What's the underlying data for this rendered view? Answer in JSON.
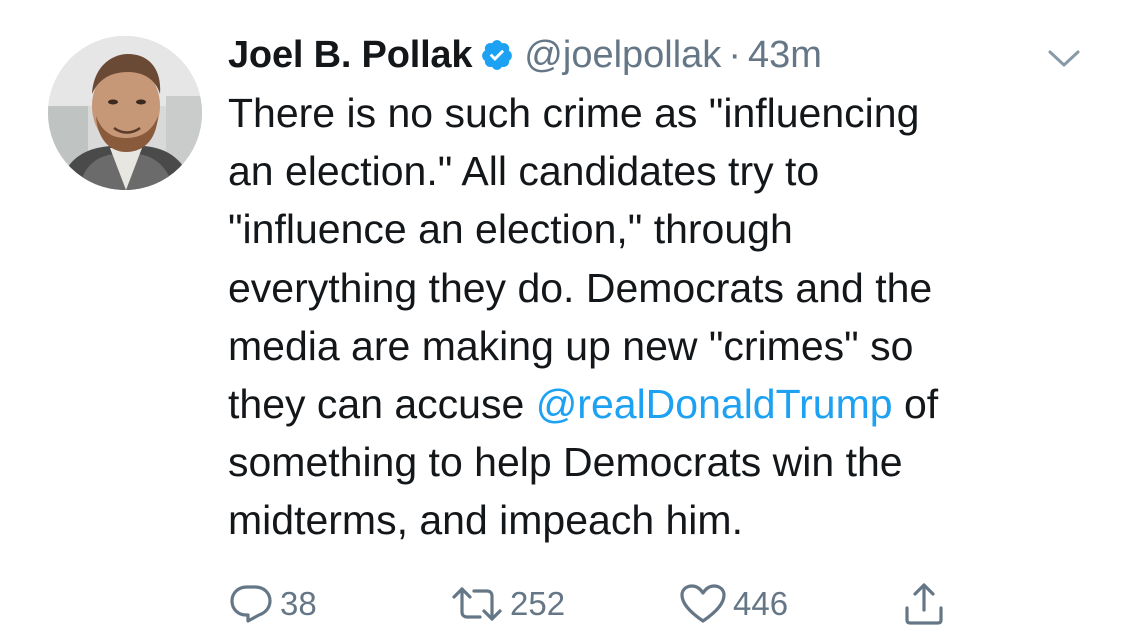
{
  "tweet": {
    "display_name": "Joel B. Pollak",
    "handle": "@joelpollak",
    "separator": "·",
    "time": "43m",
    "verified": true,
    "body_lines": [
      "There is no such crime as \"influencing",
      "an election.\" All candidates try to",
      "\"influence an election,\" through",
      "everything they do. Democrats and the",
      "media are making up new \"crimes\" so",
      "they can accuse ",
      "something to help Democrats win the",
      "midterms, and impeach him."
    ],
    "mention": "@realDonaldTrump",
    "after_mention": " of"
  },
  "actions": {
    "replies": "38",
    "retweets": "252",
    "likes": "446"
  },
  "icons": {
    "verified": "verified-badge-icon",
    "caret": "chevron-down-icon",
    "reply": "reply-icon",
    "retweet": "retweet-icon",
    "like": "heart-icon",
    "share": "share-icon"
  },
  "colors": {
    "text": "#14171a",
    "secondary": "#657786",
    "link": "#1da1f2",
    "verified": "#1da1f2"
  }
}
